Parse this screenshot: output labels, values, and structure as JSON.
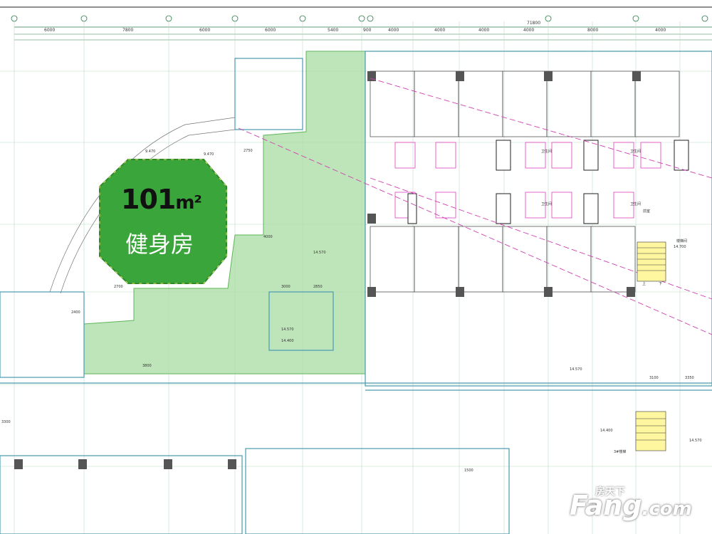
{
  "highlight": {
    "area_value": "101",
    "area_unit": "m²",
    "room_name": "健身房",
    "color": "#2fa32f"
  },
  "watermark": {
    "brand_cn": "房天下",
    "brand_en": "Fang",
    "brand_suffix": ".com"
  },
  "drawing": {
    "top_dimensions": [
      "6000",
      "7800",
      "6000",
      "6000",
      "5400",
      "900",
      "4000",
      "4000",
      "4000",
      "4000",
      "8000",
      "4000"
    ],
    "overall_dimension": "71800",
    "elevations": [
      "9.470",
      "9.470",
      "14.570",
      "14.570",
      "14.570",
      "14.400",
      "14.700",
      "14.400",
      "14.570"
    ],
    "room_tags": [
      "卫生间",
      "卫生间",
      "卫生间",
      "卫生间",
      "前室",
      "楼梯间",
      "3#楼梯"
    ],
    "stair_labels": [
      "上",
      "下"
    ],
    "misc_dims": [
      "2700",
      "2400",
      "3800",
      "3000",
      "2850",
      "3100",
      "3350",
      "4000",
      "2750",
      "1500",
      "3300"
    ]
  }
}
